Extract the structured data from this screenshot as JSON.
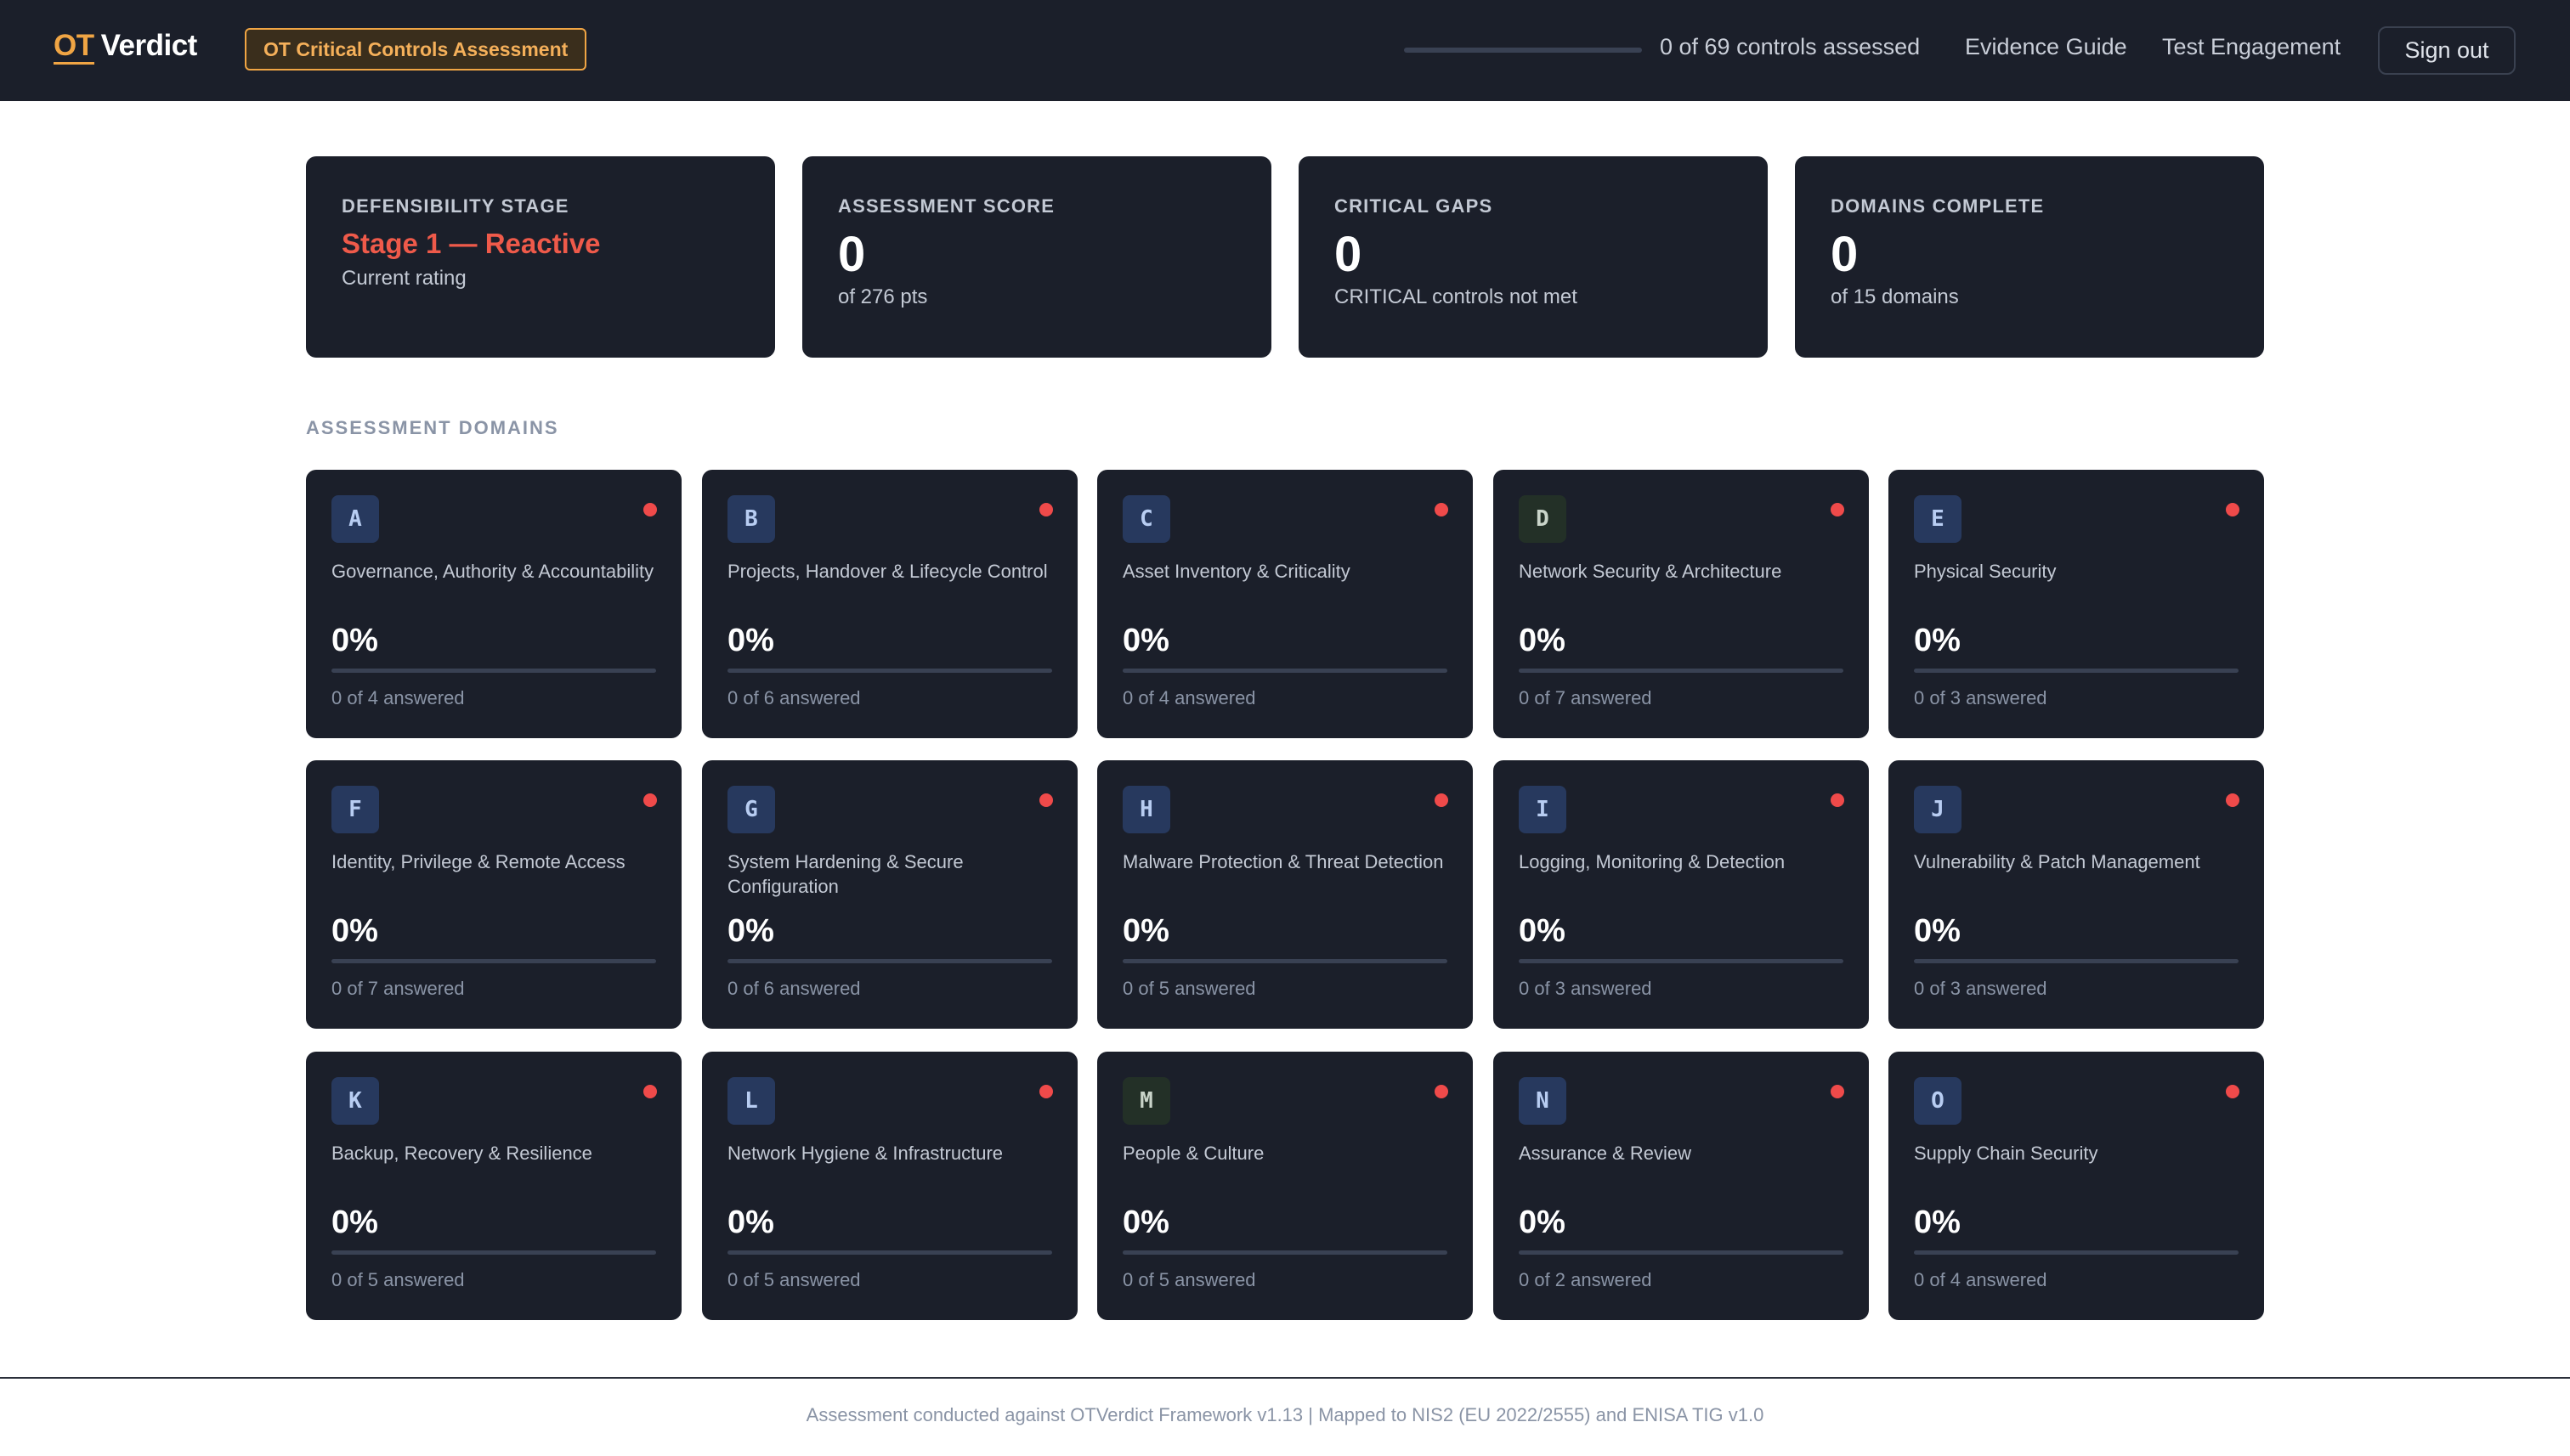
{
  "header": {
    "brand_ot": "OT",
    "brand_name": "Verdict",
    "mode_badge": "OT Critical Controls Assessment",
    "progress_fraction": 0,
    "progress_text": "0 of 69 controls assessed",
    "nav": {
      "evidence_guide": "Evidence Guide",
      "test_engagement": "Test Engagement",
      "sign_out": "Sign out"
    }
  },
  "summary": {
    "stage": {
      "label": "DEFENSIBILITY STAGE",
      "value": "Stage 1 — Reactive",
      "sub": "Current rating"
    },
    "score": {
      "label": "ASSESSMENT SCORE",
      "value": "0",
      "sub": "of 276 pts"
    },
    "gaps": {
      "label": "CRITICAL GAPS",
      "value": "0",
      "sub": "CRITICAL controls not met"
    },
    "domains": {
      "label": "DOMAINS COMPLETE",
      "value": "0",
      "sub": "of 15 domains"
    }
  },
  "section_title": "ASSESSMENT DOMAINS",
  "domains": [
    {
      "letter": "A",
      "name": "Governance, Authority & Accountability",
      "percent": "0%",
      "answered": "0 of 4 answered"
    },
    {
      "letter": "B",
      "name": "Projects, Handover & Lifecycle Control",
      "percent": "0%",
      "answered": "0 of 6 answered"
    },
    {
      "letter": "C",
      "name": "Asset Inventory & Criticality",
      "percent": "0%",
      "answered": "0 of 4 answered"
    },
    {
      "letter": "D",
      "name": "Network Security & Architecture",
      "percent": "0%",
      "answered": "0 of 7 answered"
    },
    {
      "letter": "E",
      "name": "Physical Security",
      "percent": "0%",
      "answered": "0 of 3 answered"
    },
    {
      "letter": "F",
      "name": "Identity, Privilege & Remote Access",
      "percent": "0%",
      "answered": "0 of 7 answered"
    },
    {
      "letter": "G",
      "name": "System Hardening & Secure Configuration",
      "percent": "0%",
      "answered": "0 of 6 answered"
    },
    {
      "letter": "H",
      "name": "Malware Protection & Threat Detection",
      "percent": "0%",
      "answered": "0 of 5 answered"
    },
    {
      "letter": "I",
      "name": "Logging, Monitoring & Detection",
      "percent": "0%",
      "answered": "0 of 3 answered"
    },
    {
      "letter": "J",
      "name": "Vulnerability & Patch Management",
      "percent": "0%",
      "answered": "0 of 3 answered"
    },
    {
      "letter": "K",
      "name": "Backup, Recovery & Resilience",
      "percent": "0%",
      "answered": "0 of 5 answered"
    },
    {
      "letter": "L",
      "name": "Network Hygiene & Infrastructure",
      "percent": "0%",
      "answered": "0 of 5 answered"
    },
    {
      "letter": "M",
      "name": "People & Culture",
      "percent": "0%",
      "answered": "0 of 5 answered"
    },
    {
      "letter": "N",
      "name": "Assurance & Review",
      "percent": "0%",
      "answered": "0 of 2 answered"
    },
    {
      "letter": "O",
      "name": "Supply Chain Security",
      "percent": "0%",
      "answered": "0 of 4 answered"
    }
  ],
  "footer": "Assessment conducted against OTVerdict Framework v1.13 | Mapped to NIS2 (EU 2022/2555) and ENISA TIG v1.0",
  "colors": {
    "accent": "#f0a544",
    "status_not_started": "#ef4a4a",
    "stage_reactive": "#ef5a4a",
    "panel": "#1b1f2a"
  }
}
